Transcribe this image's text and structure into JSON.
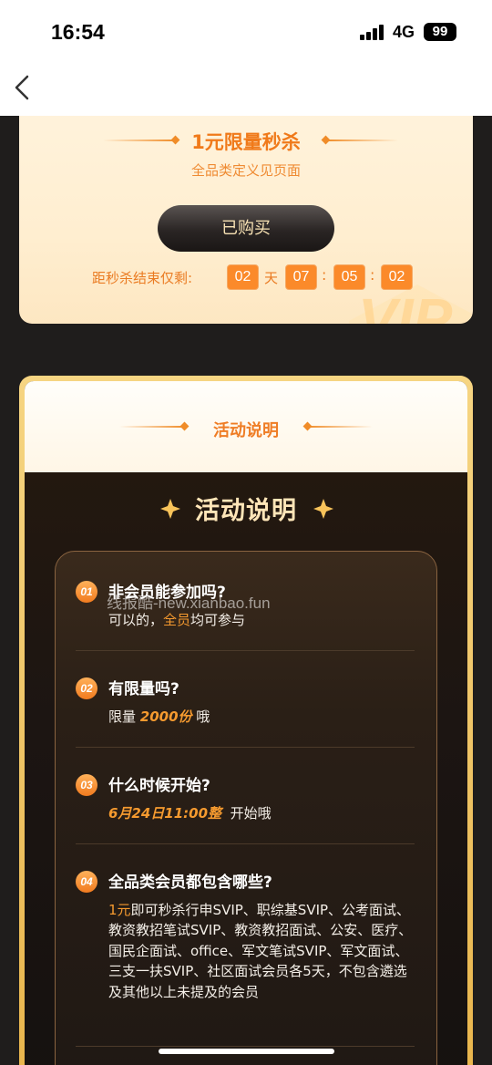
{
  "status_bar": {
    "time": "16:54",
    "network": "4G",
    "battery": "99"
  },
  "flash_sale": {
    "title": "1元限量秒杀",
    "subtitle": "全品类定义见页面",
    "button": "已购买",
    "countdown_label": "距秒杀结束仅剩:",
    "days": "02",
    "days_unit": "天",
    "hours": "07",
    "minutes": "05",
    "seconds": "02",
    "sep": ":"
  },
  "activity": {
    "header": "活动说明",
    "big_title": "活动说明",
    "items": [
      {
        "num": "01",
        "question": "非会员能参加吗?",
        "a_pre": "可以的，",
        "a_hl": "全员",
        "a_post": "均可参与"
      },
      {
        "num": "02",
        "question": "有限量吗?",
        "a_pre": "限量 ",
        "a_hl": "2000份",
        "a_post": " 哦"
      },
      {
        "num": "03",
        "question": "什么时候开始?",
        "a_hl": "6月24日11:00整",
        "a_post": "  开始哦"
      },
      {
        "num": "04",
        "question": "全品类会员都包含哪些?",
        "a_hl": "1元",
        "a_post": "即可秒杀行申SVIP、职综基SVIP、公考面试、教资教招笔试SVIP、教资教招面试、公安、医疗、国民企面试、office、军文笔试SVIP、军文面试、三支一扶SVIP、社区面试会员各5天，不包含遴选及其他以上未提及的会员"
      }
    ]
  },
  "watermark": "线报酷-new.xianbao.fun",
  "colors": {
    "accent": "#f07a1a",
    "dark_bg": "#1f1d1c",
    "gold": "#f6d582"
  }
}
